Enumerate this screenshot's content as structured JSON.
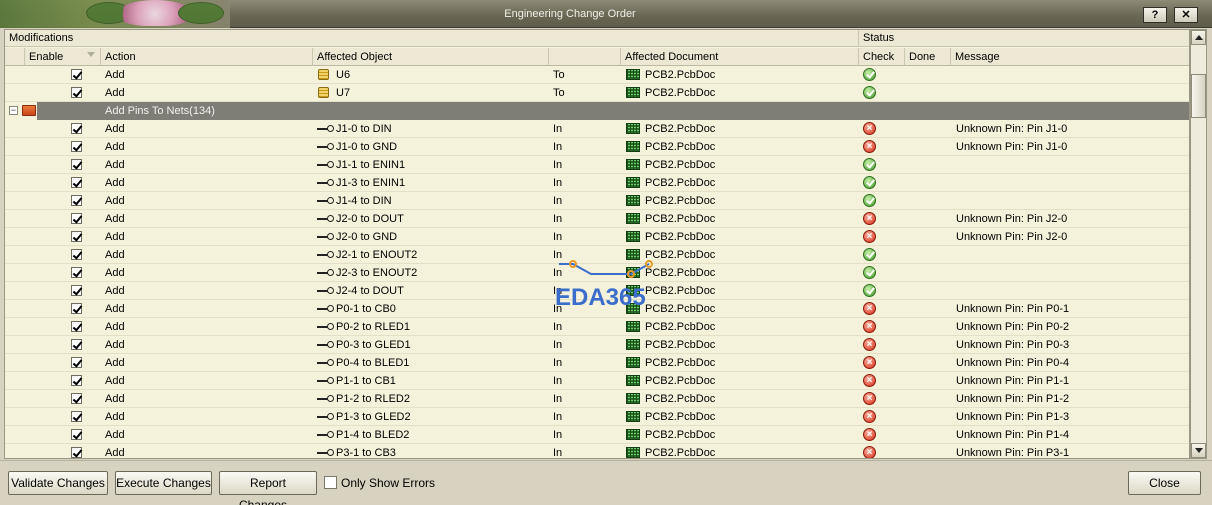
{
  "window": {
    "title": "Engineering Change Order",
    "help_label": "?",
    "close_label": "✕"
  },
  "groups": {
    "modifications": "Modifications",
    "status": "Status"
  },
  "columns": {
    "enable": "Enable",
    "action": "Action",
    "affected_object": "Affected Object",
    "affected_document": "Affected Document",
    "check": "Check",
    "done": "Done",
    "message": "Message"
  },
  "group_row": {
    "label": "Add Pins To Nets(134)"
  },
  "rows_top": [
    {
      "action": "Add",
      "object": "U6",
      "direction": "To",
      "document": "PCB2.PcbDoc",
      "check": "ok",
      "message": ""
    },
    {
      "action": "Add",
      "object": "U7",
      "direction": "To",
      "document": "PCB2.PcbDoc",
      "check": "ok",
      "message": ""
    }
  ],
  "rows": [
    {
      "action": "Add",
      "object": "J1-0 to DIN",
      "direction": "In",
      "document": "PCB2.PcbDoc",
      "check": "error",
      "message": "Unknown Pin: Pin J1-0"
    },
    {
      "action": "Add",
      "object": "J1-0 to GND",
      "direction": "In",
      "document": "PCB2.PcbDoc",
      "check": "error",
      "message": "Unknown Pin: Pin J1-0"
    },
    {
      "action": "Add",
      "object": "J1-1 to ENIN1",
      "direction": "In",
      "document": "PCB2.PcbDoc",
      "check": "ok",
      "message": ""
    },
    {
      "action": "Add",
      "object": "J1-3 to ENIN1",
      "direction": "In",
      "document": "PCB2.PcbDoc",
      "check": "ok",
      "message": ""
    },
    {
      "action": "Add",
      "object": "J1-4 to DIN",
      "direction": "In",
      "document": "PCB2.PcbDoc",
      "check": "ok",
      "message": ""
    },
    {
      "action": "Add",
      "object": "J2-0 to DOUT",
      "direction": "In",
      "document": "PCB2.PcbDoc",
      "check": "error",
      "message": "Unknown Pin: Pin J2-0"
    },
    {
      "action": "Add",
      "object": "J2-0 to GND",
      "direction": "In",
      "document": "PCB2.PcbDoc",
      "check": "error",
      "message": "Unknown Pin: Pin J2-0"
    },
    {
      "action": "Add",
      "object": "J2-1 to ENOUT2",
      "direction": "In",
      "document": "PCB2.PcbDoc",
      "check": "ok",
      "message": ""
    },
    {
      "action": "Add",
      "object": "J2-3 to ENOUT2",
      "direction": "In",
      "document": "PCB2.PcbDoc",
      "check": "ok",
      "message": ""
    },
    {
      "action": "Add",
      "object": "J2-4 to DOUT",
      "direction": "In",
      "document": "PCB2.PcbDoc",
      "check": "ok",
      "message": ""
    },
    {
      "action": "Add",
      "object": "P0-1 to CB0",
      "direction": "In",
      "document": "PCB2.PcbDoc",
      "check": "error",
      "message": "Unknown Pin: Pin P0-1"
    },
    {
      "action": "Add",
      "object": "P0-2 to RLED1",
      "direction": "In",
      "document": "PCB2.PcbDoc",
      "check": "error",
      "message": "Unknown Pin: Pin P0-2"
    },
    {
      "action": "Add",
      "object": "P0-3 to GLED1",
      "direction": "In",
      "document": "PCB2.PcbDoc",
      "check": "error",
      "message": "Unknown Pin: Pin P0-3"
    },
    {
      "action": "Add",
      "object": "P0-4 to BLED1",
      "direction": "In",
      "document": "PCB2.PcbDoc",
      "check": "error",
      "message": "Unknown Pin: Pin P0-4"
    },
    {
      "action": "Add",
      "object": "P1-1 to CB1",
      "direction": "In",
      "document": "PCB2.PcbDoc",
      "check": "error",
      "message": "Unknown Pin: Pin P1-1"
    },
    {
      "action": "Add",
      "object": "P1-2 to RLED2",
      "direction": "In",
      "document": "PCB2.PcbDoc",
      "check": "error",
      "message": "Unknown Pin: Pin P1-2"
    },
    {
      "action": "Add",
      "object": "P1-3 to GLED2",
      "direction": "In",
      "document": "PCB2.PcbDoc",
      "check": "error",
      "message": "Unknown Pin: Pin P1-3"
    },
    {
      "action": "Add",
      "object": "P1-4 to BLED2",
      "direction": "In",
      "document": "PCB2.PcbDoc",
      "check": "error",
      "message": "Unknown Pin: Pin P1-4"
    },
    {
      "action": "Add",
      "object": "P3-1 to CB3",
      "direction": "In",
      "document": "PCB2.PcbDoc",
      "check": "error",
      "message": "Unknown Pin: Pin P3-1"
    }
  ],
  "buttons": {
    "validate": "Validate Changes",
    "execute": "Execute Changes",
    "report": "Report Changes...",
    "only_errors": "Only Show Errors",
    "close": "Close"
  },
  "watermark": {
    "text": "EDA365"
  },
  "colors": {
    "ok": "#3f9a2a",
    "error": "#d22a12",
    "group_row": "#7e7d76",
    "grid_bg": "#f5f2dc"
  }
}
